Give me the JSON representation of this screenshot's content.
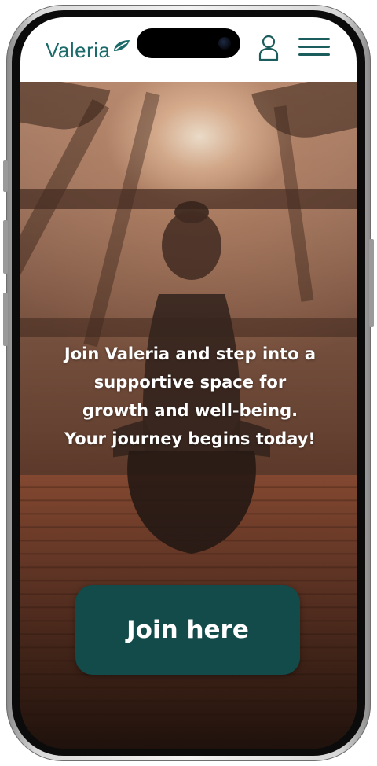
{
  "header": {
    "brand_name": "Valeria",
    "brand_color": "#1b6b6b",
    "profile_icon": "user-icon",
    "menu_icon": "hamburger-menu-icon"
  },
  "hero": {
    "message": "Join Valeria and step into a supportive space for growth and well-being. Your journey begins today!",
    "background_image": "woman meditating at sunrise on wooden deck with palm trees",
    "cta_label": "Join here",
    "cta_color": "#134b4a"
  }
}
